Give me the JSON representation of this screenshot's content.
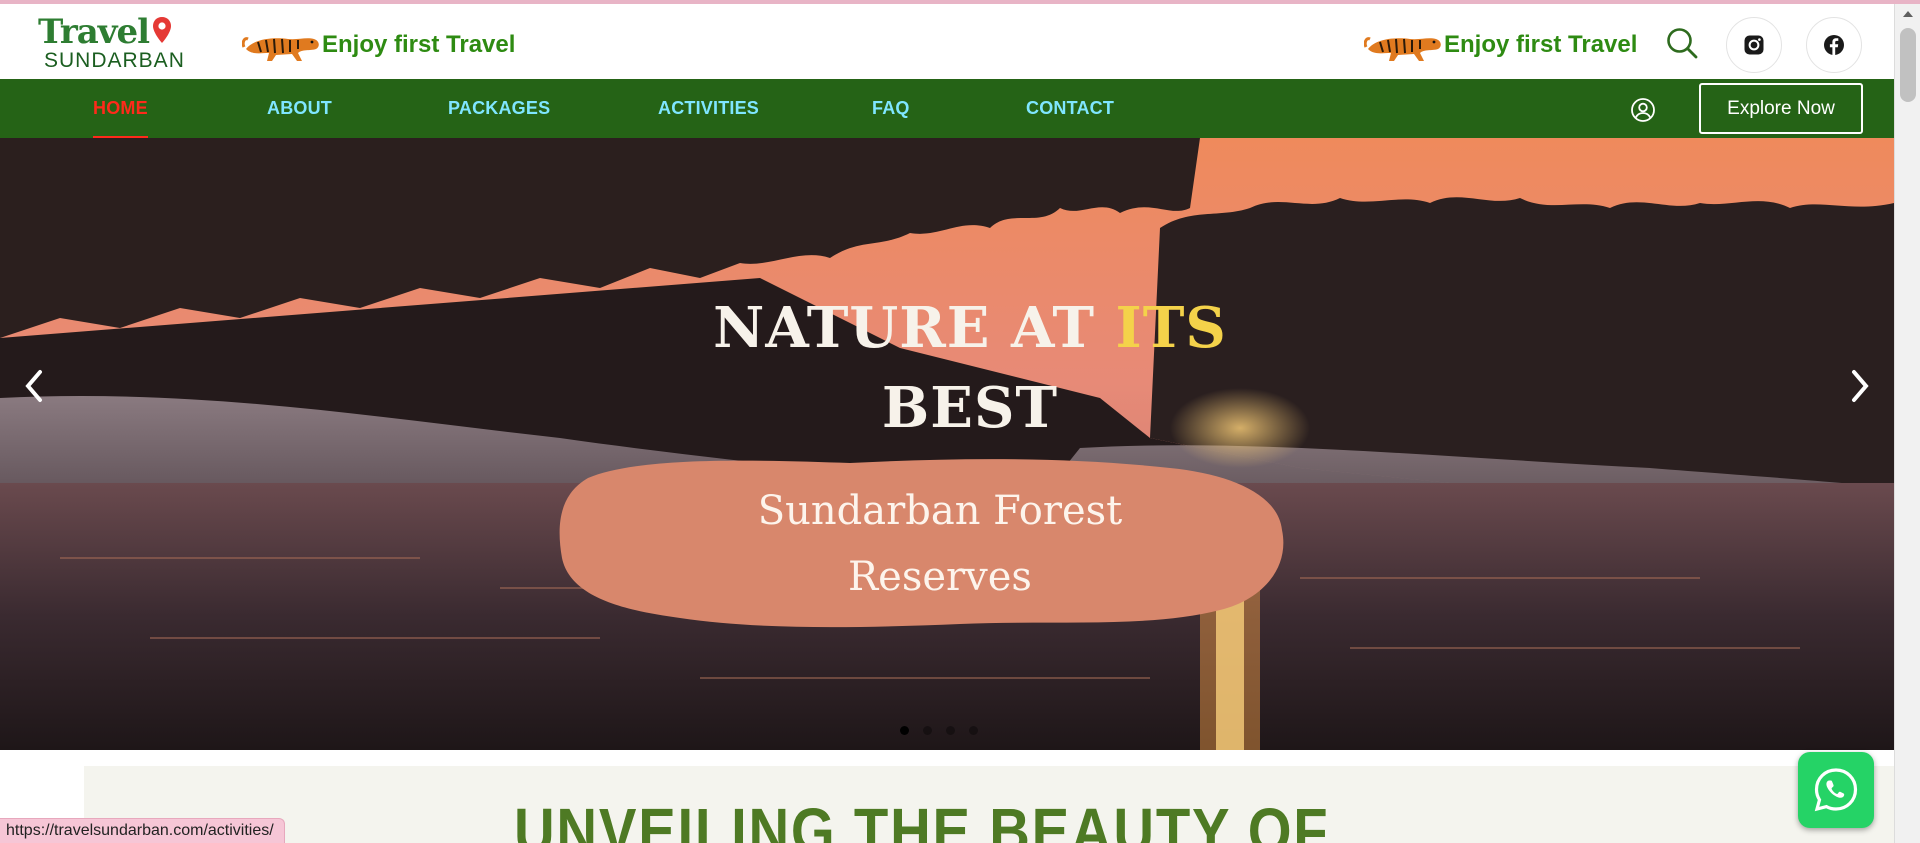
{
  "header": {
    "logo": {
      "word": "Travel",
      "sub": "SUNDARBAN"
    },
    "tagline_left": "Enjoy first Travel",
    "tagline_right": "Enjoy first Travel",
    "icons": [
      "search-icon",
      "instagram-icon",
      "facebook-icon"
    ]
  },
  "nav": {
    "items": [
      {
        "label": "HOME",
        "active": true
      },
      {
        "label": "ABOUT",
        "active": false
      },
      {
        "label": "PACKAGES",
        "active": false
      },
      {
        "label": "ACTIVITIES",
        "active": false
      },
      {
        "label": "FAQ",
        "active": false
      },
      {
        "label": "CONTACT",
        "active": false
      }
    ],
    "explore_label": "Explore Now",
    "colors": {
      "bar": "#256316",
      "link": "#7fe6ff",
      "active": "#ff2a1a"
    }
  },
  "hero": {
    "title_part1": "NATURE AT ",
    "title_highlight": "ITS",
    "title_part2": "BEST",
    "subtitle_line1": "Sundarban Forest",
    "subtitle_line2": "Reserves",
    "slides_total": 4,
    "active_slide": 1
  },
  "section": {
    "title": "UNVEILING THE BEAUTY OF"
  },
  "status_bar": {
    "url": "https://travelsundarban.com/activities/"
  }
}
